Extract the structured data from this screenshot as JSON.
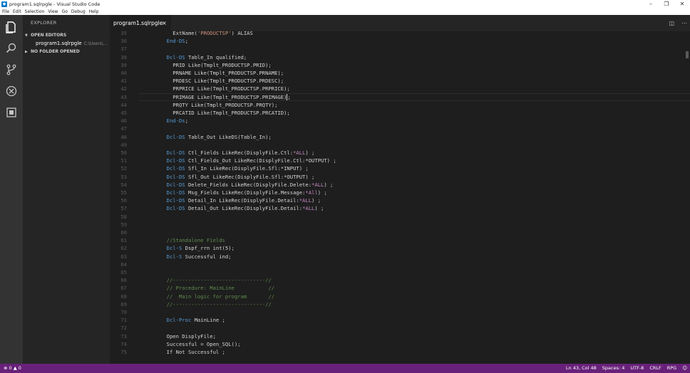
{
  "window": {
    "title": "program1.sqlrpgle - Visual Studio Code"
  },
  "menu": [
    "File",
    "Edit",
    "Selection",
    "View",
    "Go",
    "Debug",
    "Help"
  ],
  "sidebar": {
    "title": "EXPLORER",
    "open_editors_label": "OPEN EDITORS",
    "open_file_name": "program1.sqlrpgle",
    "open_file_path": "C:\\Users\\...",
    "no_folder_label": "NO FOLDER OPENED"
  },
  "tab": {
    "label": "program1.sqlrpgle",
    "close_glyph": "×"
  },
  "status": {
    "problems": "⊗ 0 ▲ 0",
    "position": "Ln 43, Col 48",
    "spaces": "Spaces: 4",
    "encoding": "UTF-8",
    "eol": "CRLF",
    "language": "RPG",
    "feedback_glyph": "☺"
  },
  "colors": {
    "statusbar": "#68217a",
    "keyword": "#c586c0",
    "comment": "#608b4e",
    "string": "#ce9178",
    "editor_bg": "#1e1e1e"
  },
  "editor": {
    "current_line": 43,
    "lines": [
      {
        "n": "35",
        "t": "    ExtName('PRODUCTSP') ALIAS"
      },
      {
        "n": "36",
        "t": "  End-DS;"
      },
      {
        "n": "37",
        "t": ""
      },
      {
        "n": "38",
        "t": "  Dcl-DS Table_In qualified;"
      },
      {
        "n": "39",
        "t": "    PRID Like(Tmplt_PRODUCTSP.PRID);"
      },
      {
        "n": "40",
        "t": "    PRNAME Like(Tmplt_PRODUCTSP.PRNAME);"
      },
      {
        "n": "41",
        "t": "    PRDESC Like(Tmplt_PRODUCTSP.PRDESC);"
      },
      {
        "n": "42",
        "t": "    PRPRICE Like(Tmplt_PRODUCTSP.PRPRICE);"
      },
      {
        "n": "43",
        "t": "    PRIMAGE Like(Tmplt_PRODUCTSP.PRIMAGE);"
      },
      {
        "n": "44",
        "t": "    PRQTY Like(Tmplt_PRODUCTSP.PRQTY);"
      },
      {
        "n": "45",
        "t": "    PRCATID Like(Tmplt_PRODUCTSP.PRCATID);"
      },
      {
        "n": "46",
        "t": "  End-Ds;"
      },
      {
        "n": "47",
        "t": ""
      },
      {
        "n": "48",
        "t": "  Dcl-DS Table_Out LikeDS(Table_In);"
      },
      {
        "n": "49",
        "t": ""
      },
      {
        "n": "50",
        "t": "  Dcl-DS Ctl_Fields LikeRec(DisplyFile.Ctl:*ALL) ;"
      },
      {
        "n": "51",
        "t": "  Dcl-DS Ctl_Fields_Out LikeRec(DisplyFile.Ctl:*OUTPUT) ;"
      },
      {
        "n": "52",
        "t": "  Dcl-DS Sfl_In LikeRec(DisplyFile.Sfl:*INPUT) ;"
      },
      {
        "n": "53",
        "t": "  Dcl-DS Sfl_Out LikeRec(DisplyFile.Sfl:*OUTPUT) ;"
      },
      {
        "n": "54",
        "t": "  Dcl-DS Delete_Fields LikeRec(DisplyFile.Delete:*ALL) ;"
      },
      {
        "n": "55",
        "t": "  Dcl-DS Msg_Fields LikeRec(DisplyFile.Message:*All) ;"
      },
      {
        "n": "56",
        "t": "  Dcl-DS Detail_In LikeRec(DisplyFile.Detail:*ALL) ;"
      },
      {
        "n": "57",
        "t": "  Dcl-DS Detail_Out LikeRec(DisplyFile.Detail:*ALL) ;"
      },
      {
        "n": "58",
        "t": ""
      },
      {
        "n": "59",
        "t": ""
      },
      {
        "n": "60",
        "t": ""
      },
      {
        "n": "61",
        "t": "  //Standalone Fields"
      },
      {
        "n": "62",
        "t": "  Dcl-S Dspf_rrn int(5);"
      },
      {
        "n": "63",
        "t": "  Dcl-S Successful ind;"
      },
      {
        "n": "64",
        "t": ""
      },
      {
        "n": "65",
        "t": ""
      },
      {
        "n": "66",
        "t": "  //------------------------------//"
      },
      {
        "n": "67",
        "t": "  // Procedure: MainLine           //"
      },
      {
        "n": "68",
        "t": "  //  Main logic for program       //"
      },
      {
        "n": "69",
        "t": "  //------------------------------//"
      },
      {
        "n": "70",
        "t": ""
      },
      {
        "n": "71",
        "t": "  Dcl-Proc MainLine ;"
      },
      {
        "n": "72",
        "t": ""
      },
      {
        "n": "73",
        "t": "  Open DisplyFile;"
      },
      {
        "n": "74",
        "t": "  Successful = Open_SQL();"
      },
      {
        "n": "75",
        "t": "  If Not Successful ;"
      }
    ]
  }
}
